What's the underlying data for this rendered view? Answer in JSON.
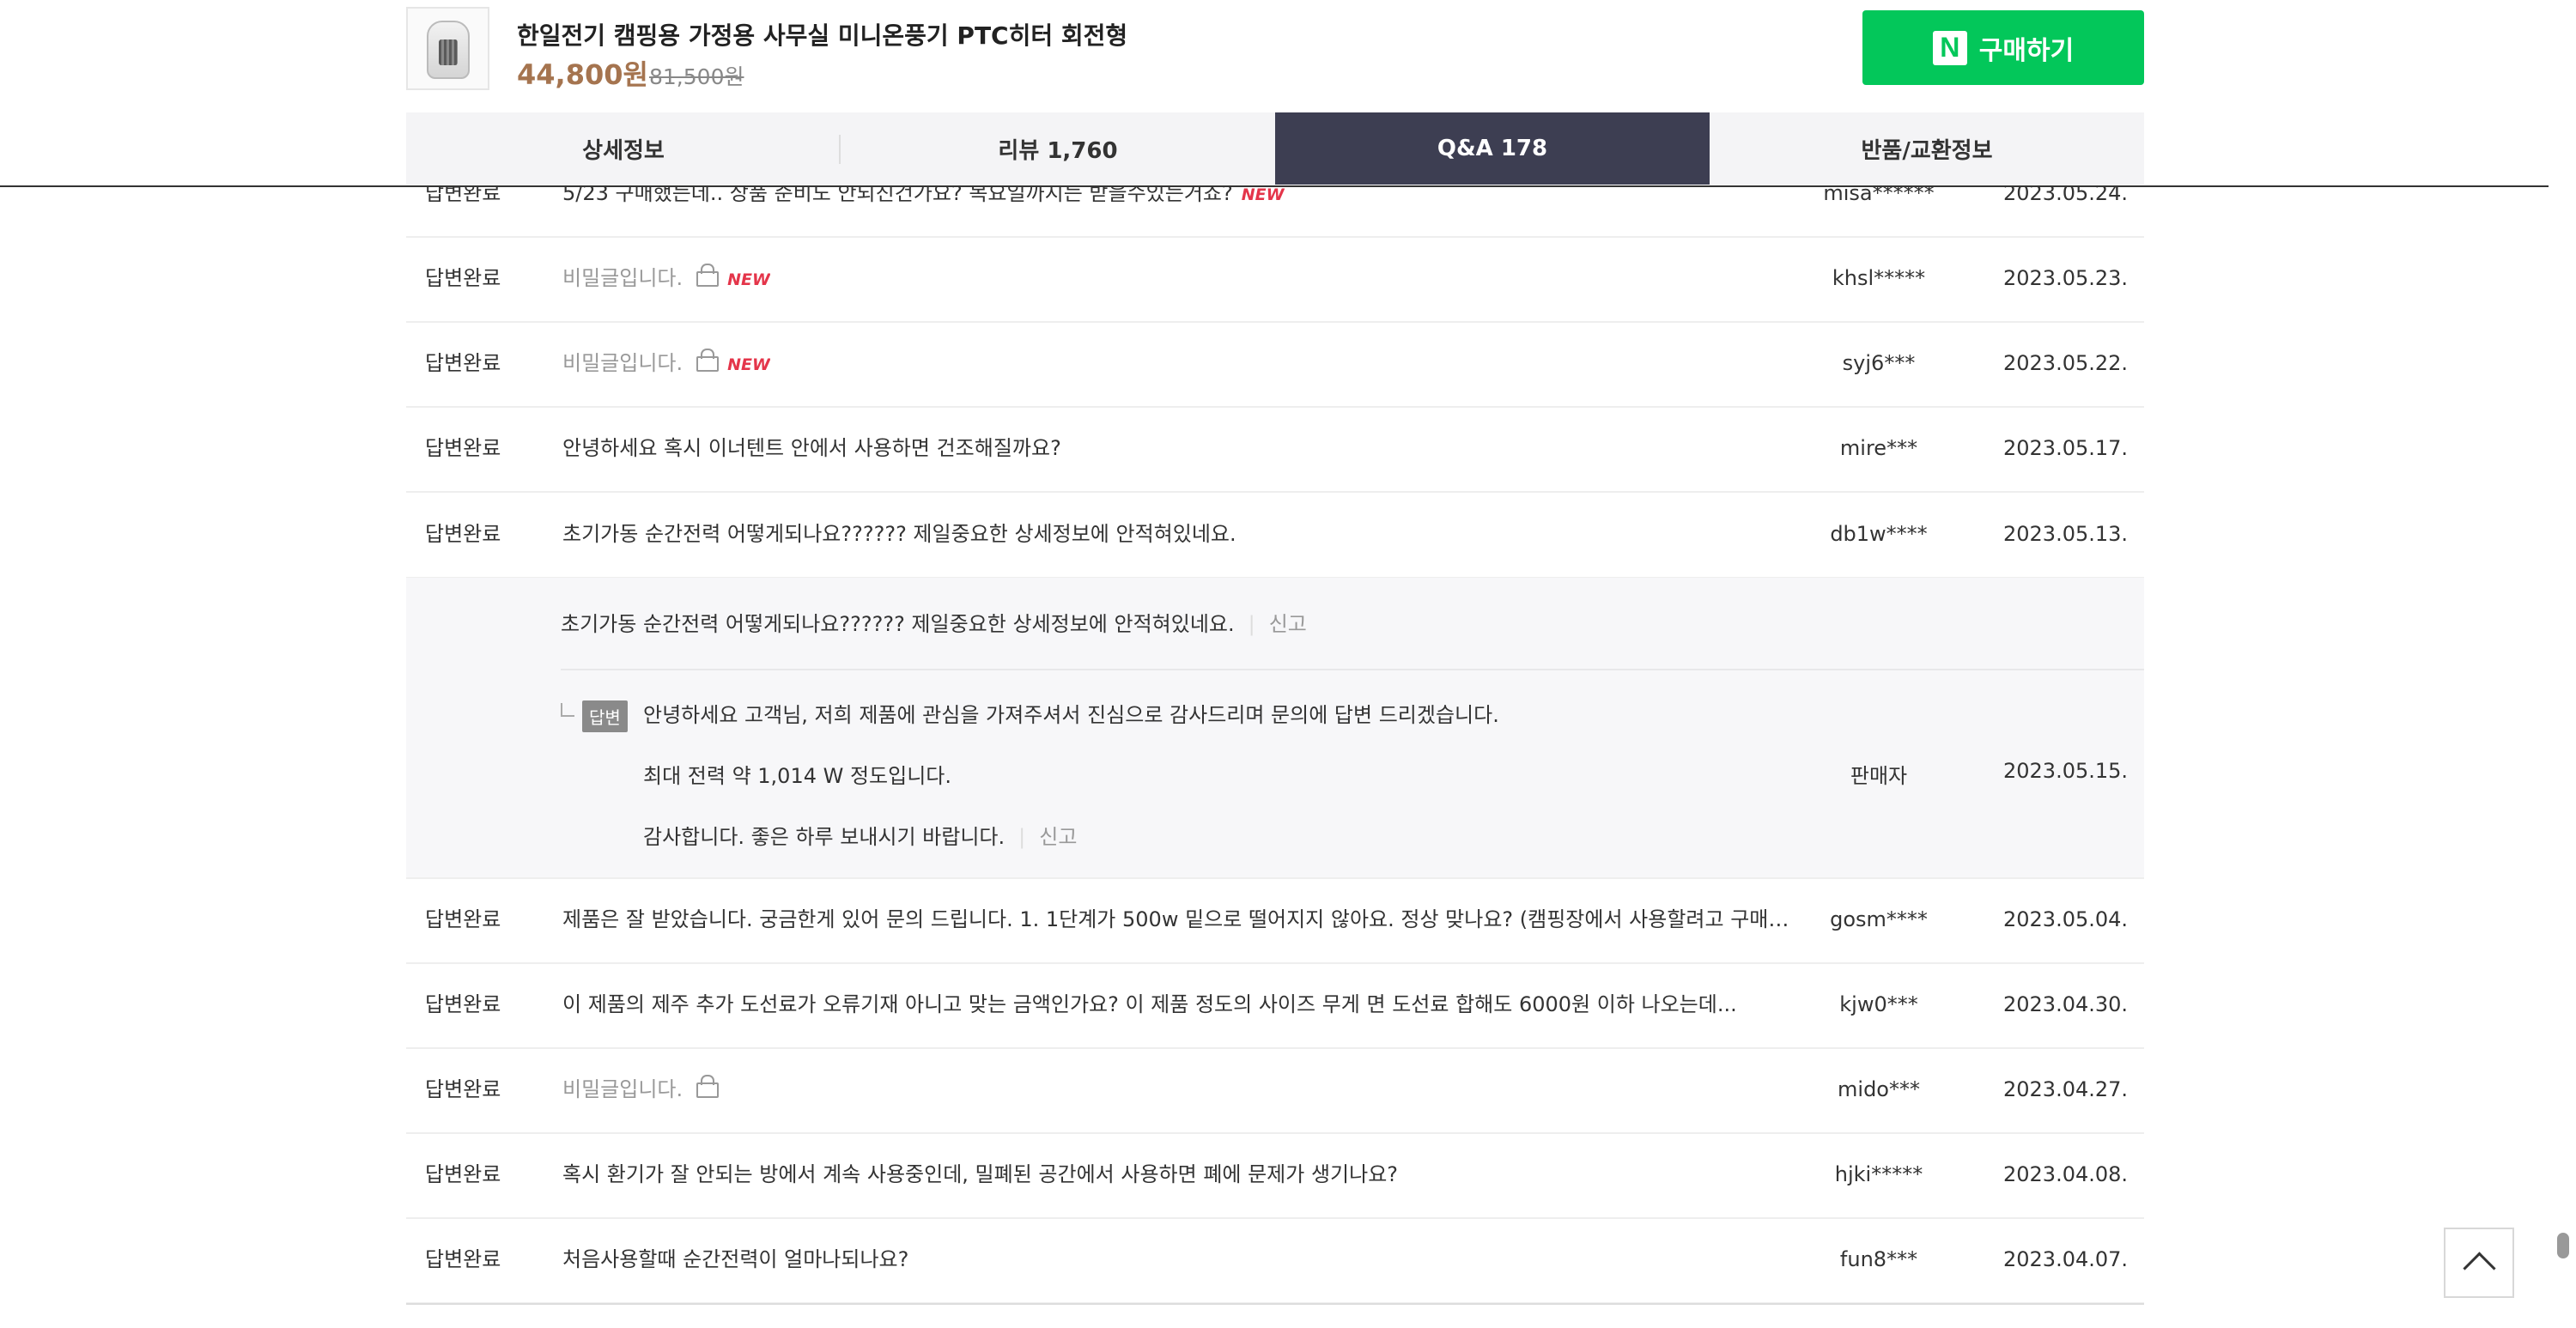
{
  "product": {
    "title": "한일전기 캠핑용 가정용 사무실 미니온풍기 PTC히터 회전형",
    "price": "44,800원",
    "original_price": "81,500원"
  },
  "buy": {
    "logo": "N",
    "label": "구매하기"
  },
  "tabs": [
    {
      "label": "상세정보"
    },
    {
      "label": "리뷰 1,760"
    },
    {
      "label": "Q&A 178"
    },
    {
      "label": "반품/교환정보"
    }
  ],
  "rows": [
    {
      "status": "답변완료",
      "title": "5/23 구매했는데.. 상품 준비도 안되진건가요? 목요일까지는 받을수있는거죠?",
      "new": "NEW",
      "author": "misa******",
      "date": "2023.05.24."
    },
    {
      "status": "답변완료",
      "title": "비밀글입니다.",
      "new": "NEW",
      "author": "khsl*****",
      "date": "2023.05.23."
    },
    {
      "status": "답변완료",
      "title": "비밀글입니다.",
      "new": "NEW",
      "author": "syj6***",
      "date": "2023.05.22."
    },
    {
      "status": "답변완료",
      "title": "안녕하세요 혹시 이너텐트 안에서 사용하면 건조해질까요?",
      "author": "mire***",
      "date": "2023.05.17."
    },
    {
      "status": "답변완료",
      "title": "초기가동 순간전력 어떻게되나요?????? 제일중요한 상세정보에 안적혀있네요.",
      "author": "db1w****",
      "date": "2023.05.13."
    },
    {
      "status": "답변완료",
      "title": "제품은 잘 받았습니다. 궁금한게 있어 문의 드립니다. 1. 1단계가 500w 밑으로 떨어지지 않아요. 정상 맞나요? (캠핑장에서 사용할려고 구매한거...",
      "author": "gosm****",
      "date": "2023.05.04."
    },
    {
      "status": "답변완료",
      "title": "이 제품의 제주 추가 도선료가 오류기재 아니고 맞는 금액인가요? 이 제품 정도의 사이즈 무게 면 도선료 합해도 6000원 이하 나오는데...",
      "author": "kjw0***",
      "date": "2023.04.30."
    },
    {
      "status": "답변완료",
      "title": "비밀글입니다.",
      "author": "mido***",
      "date": "2023.04.27."
    },
    {
      "status": "답변완료",
      "title": "혹시 환기가 잘 안되는 방에서 계속 사용중인데, 밀폐된 공간에서 사용하면 폐에 문제가 생기나요?",
      "author": "hjki*****",
      "date": "2023.04.08."
    },
    {
      "status": "답변완료",
      "title": "처음사용할때 순간전력이 얼마나되나요?",
      "author": "fun8***",
      "date": "2023.04.07."
    }
  ],
  "expanded": {
    "question": "초기가동 순간전력 어떻게되나요?????? 제일중요한 상세정보에 안적혀있네요.",
    "report": "신고",
    "badge": "답변",
    "answer_lines": [
      "안녕하세요 고객님, 저희 제품에 관심을 가져주셔서 진심으로 감사드리며 문의에 답변 드리겠습니다.",
      "최대 전력 약 1,014 W 정도입니다.",
      "감사합니다. 좋은 하루 보내시기 바랍니다."
    ],
    "answer_report": "신고",
    "author": "판매자",
    "date": "2023.05.15."
  }
}
